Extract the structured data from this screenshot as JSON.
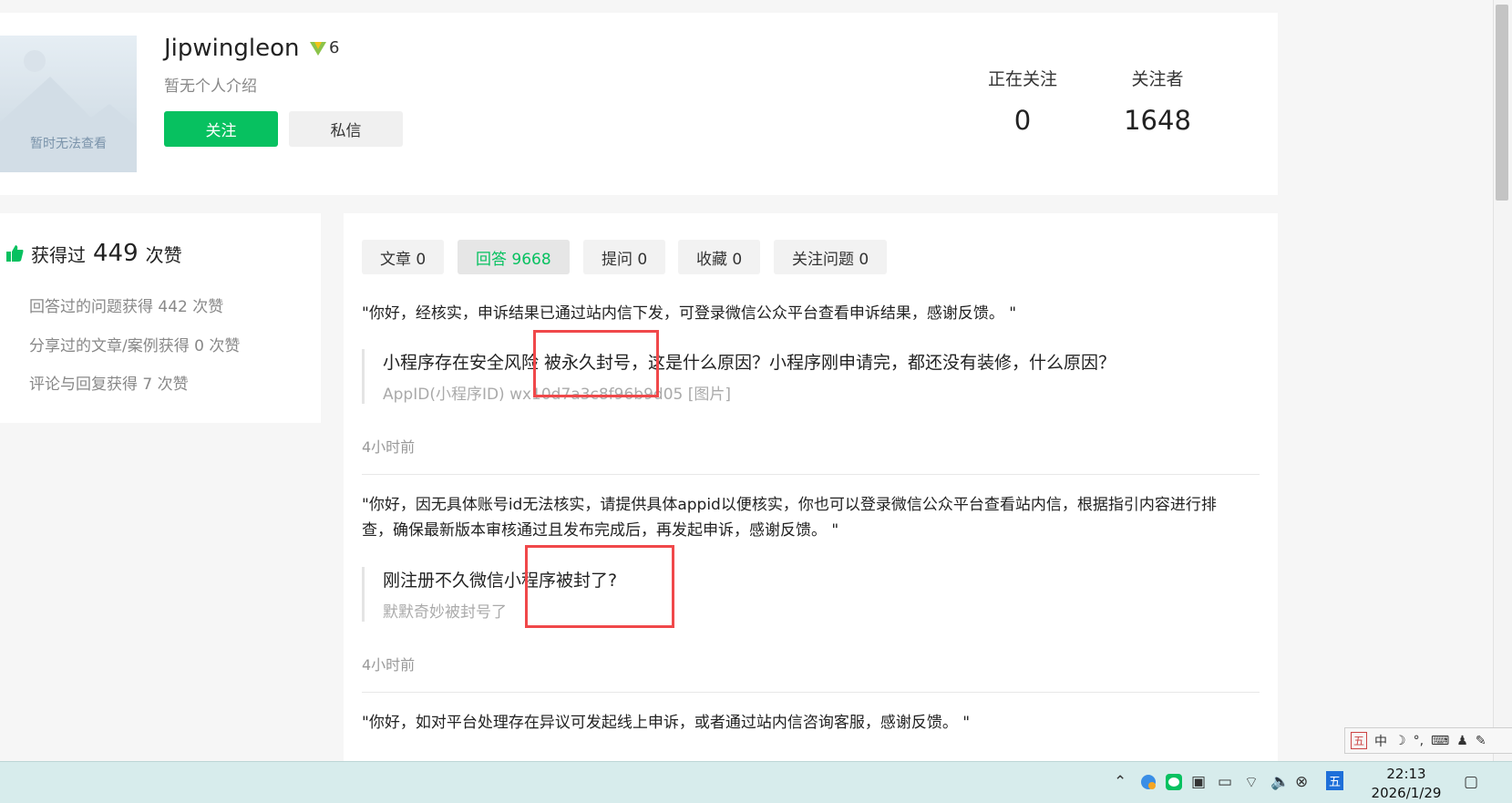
{
  "profile": {
    "avatar_caption": "暂时无法查看",
    "username": "Jipwingleon",
    "level": "6",
    "bio": "暂无个人介绍",
    "follow_label": "关注",
    "message_label": "私信",
    "stats": [
      {
        "label": "正在关注",
        "value": "0"
      },
      {
        "label": "关注者",
        "value": "1648"
      }
    ]
  },
  "likes": {
    "prefix": "获得过",
    "count": "449",
    "suffix": "次赞",
    "lines": [
      "回答过的问题获得 442 次赞",
      "分享过的文章/案例获得 0 次赞",
      "评论与回复获得 7 次赞"
    ]
  },
  "tabs": [
    {
      "label": "文章 0",
      "active": false
    },
    {
      "label": "回答 9668",
      "active": true
    },
    {
      "label": "提问 0",
      "active": false
    },
    {
      "label": "收藏 0",
      "active": false
    },
    {
      "label": "关注问题 0",
      "active": false
    }
  ],
  "answers": [
    {
      "text": "\"你好，经核实，申诉结果已通过站内信下发，可登录微信公众平台查看申诉结果，感谢反馈。 \"",
      "question": "小程序存在安全风险 被永久封号，这是什么原因？小程序刚申请完，都还没有装修，什么原因？",
      "detail": "AppID(小程序ID) wx10d7a3c8f96b9d05 [图片]",
      "time": "4小时前"
    },
    {
      "text": "\"你好，因无具体账号id无法核实，请提供具体appid以便核实，你也可以登录微信公众平台查看站内信，根据指引内容进行排查，确保最新版本审核通过且发布完成后，再发起申诉，感谢反馈。 \"",
      "question": "刚注册不久微信小程序被封了?",
      "detail": "默默奇妙被封号了",
      "time": "4小时前"
    },
    {
      "text": "\"你好，如对平台处理存在异议可发起线上申诉，或者通过站内信咨询客服，感谢反馈。 \""
    }
  ],
  "ime": {
    "mode": "中"
  },
  "tray": {
    "ime_label": "五"
  },
  "clock": {
    "time": "22:13",
    "date": "2026/1/29"
  },
  "colors": {
    "accent": "#07c160",
    "highlight": "#f0484a"
  }
}
